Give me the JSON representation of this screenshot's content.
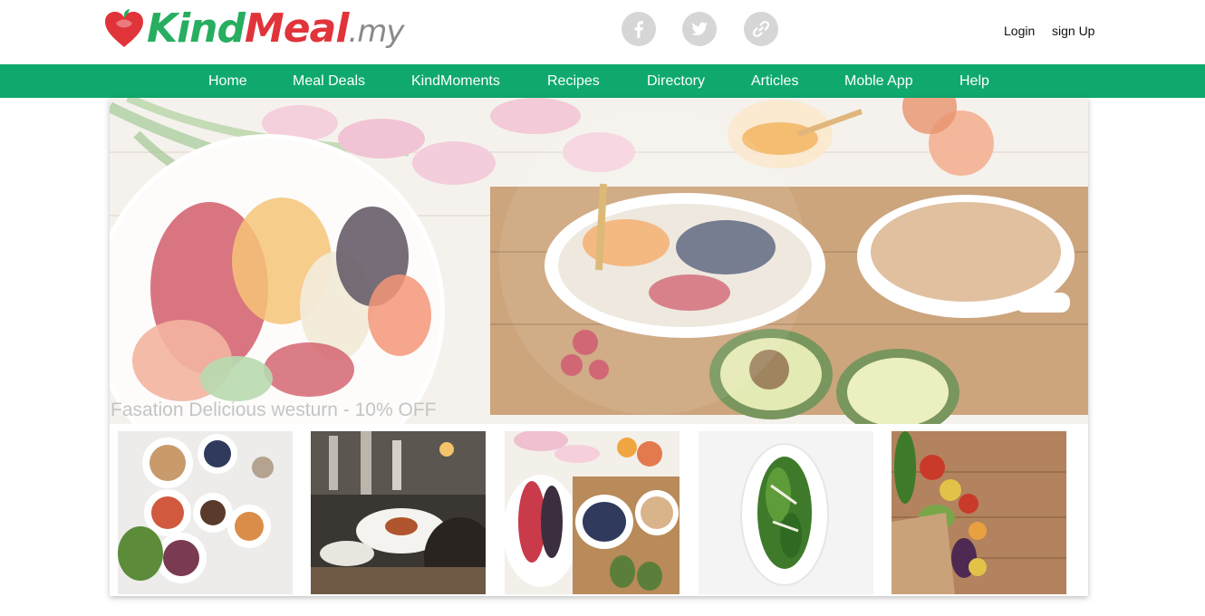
{
  "brand": {
    "logo_kind": "Kind",
    "logo_meal": "Meal",
    "logo_my": ".my"
  },
  "social": [
    {
      "name": "facebook",
      "icon": "facebook-icon"
    },
    {
      "name": "twitter",
      "icon": "twitter-icon"
    },
    {
      "name": "link",
      "icon": "link-icon"
    }
  ],
  "auth": {
    "login": "Login",
    "signup": "sign Up"
  },
  "nav": {
    "items": [
      "Home",
      "Meal Deals",
      "KindMoments",
      "Recipes",
      "Directory",
      "Articles",
      "Moble App",
      "Help"
    ]
  },
  "hero": {
    "caption": "Fasation Delicious westurn - 10% OFF"
  },
  "colors": {
    "brand_green": "#0fa96e",
    "logo_green": "#27ae60",
    "logo_red": "#e0343a",
    "icon_grey": "#d6d6d6"
  }
}
